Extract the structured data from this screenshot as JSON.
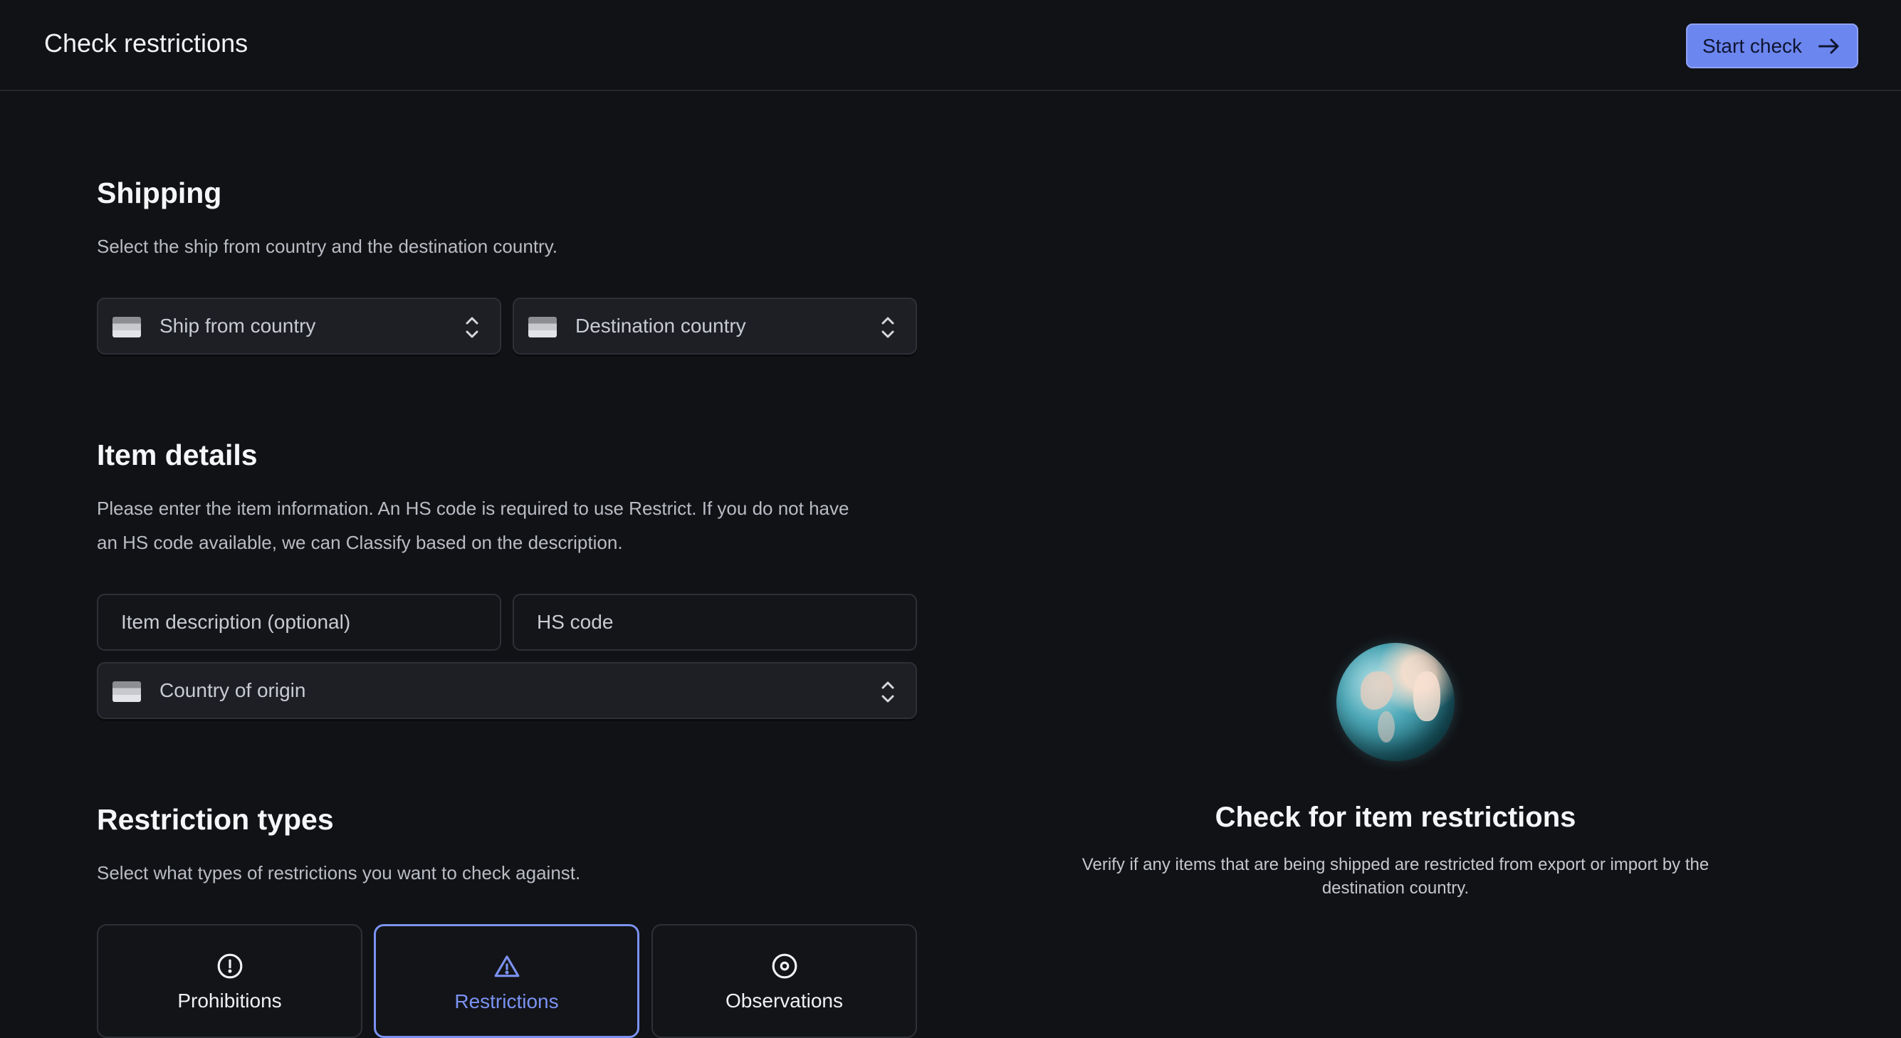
{
  "header": {
    "title": "Check restrictions",
    "start_button": "Start check"
  },
  "shipping": {
    "title": "Shipping",
    "description": "Select the ship from country and the destination country.",
    "ship_from": "Ship from country",
    "destination": "Destination country"
  },
  "item_details": {
    "title": "Item details",
    "description_line1": "Please enter the item information. An HS code is required to use Restrict. If you do not have",
    "description_line2": "an HS code available, we can Classify based on the description.",
    "item_description_placeholder": "Item description (optional)",
    "hs_code_placeholder": "HS code",
    "country_of_origin": "Country of origin"
  },
  "restriction_types": {
    "title": "Restriction types",
    "description": "Select what types of restrictions you want to check against.",
    "options": [
      {
        "label": "Prohibitions",
        "icon": "alert-circle-icon",
        "selected": false
      },
      {
        "label": "Restrictions",
        "icon": "warning-triangle-icon",
        "selected": true
      },
      {
        "label": "Observations",
        "icon": "eye-icon",
        "selected": false
      }
    ]
  },
  "empty_state": {
    "icon": "globe-icon",
    "title": "Check for item restrictions",
    "description_line1": "Verify if any items that are being shipped are restricted from export or import by the",
    "description_line2": "destination country."
  },
  "colors": {
    "background": "#111215",
    "accent": "#6c86f0",
    "selected_border": "#7b92f2"
  }
}
